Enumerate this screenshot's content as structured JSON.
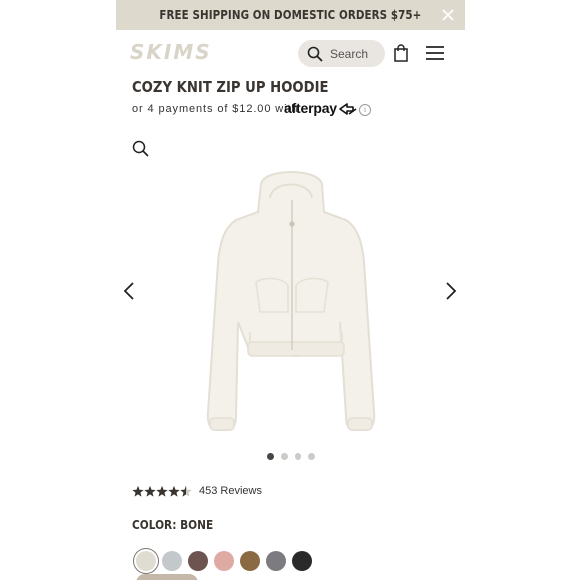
{
  "promo": {
    "text": "FREE SHIPPING ON DOMESTIC ORDERS $75+"
  },
  "header": {
    "logo": "SKIMS",
    "search_placeholder": "Search"
  },
  "product": {
    "title": "COZY KNIT ZIP UP HOODIE",
    "payment_text": "or 4 payments of $12.00 with",
    "afterpay_label": "afterpay",
    "info_glyph": "i",
    "image_count": 4,
    "active_image": 1,
    "rating_stars": 4.5,
    "reviews_label": "453 Reviews",
    "color_label": "COLOR: BONE"
  },
  "swatches": [
    {
      "name": "bone",
      "color": "#dfdcd2",
      "selected": true
    },
    {
      "name": "light-gray",
      "color": "#c3c8cb",
      "selected": false
    },
    {
      "name": "brown",
      "color": "#6d5450",
      "selected": false
    },
    {
      "name": "pink",
      "color": "#dfaaa4",
      "selected": false
    },
    {
      "name": "camel",
      "color": "#8a6a42",
      "selected": false
    },
    {
      "name": "gray",
      "color": "#7c7c80",
      "selected": false
    },
    {
      "name": "black",
      "color": "#2a2a2a",
      "selected": false
    }
  ],
  "colors": {
    "promo_bg": "#ded9cd",
    "hoodie": "#f4f1ea"
  }
}
